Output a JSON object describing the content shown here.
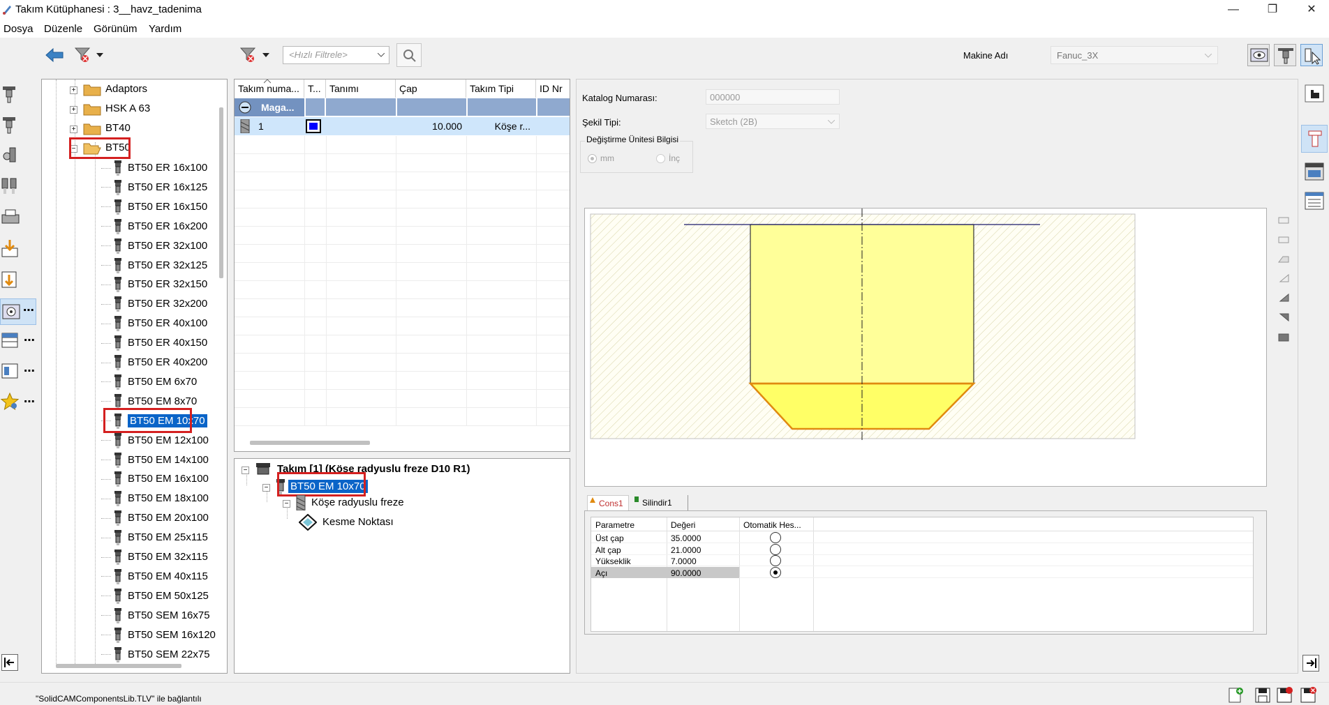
{
  "window": {
    "title": "Takım Kütüphanesi : 3__havz_tadenima",
    "minimize": "—",
    "maximize": "❐",
    "close": "✕"
  },
  "menu": [
    "Dosya",
    "Düzenle",
    "Görünüm",
    "Yardım"
  ],
  "toolbar": {
    "filter_placeholder": "<Hızlı Filtrele>",
    "machine_label": "Makine Adı",
    "machine_value": "Fanuc_3X"
  },
  "tree": {
    "folders": [
      "Adaptors",
      "HSK A 63",
      "BT40",
      "BT50"
    ],
    "items": [
      "BT50 ER 16x100",
      "BT50 ER 16x125",
      "BT50 ER 16x150",
      "BT50 ER 16x200",
      "BT50 ER 32x100",
      "BT50 ER 32x125",
      "BT50 ER 32x150",
      "BT50 ER 32x200",
      "BT50 ER 40x100",
      "BT50 ER 40x150",
      "BT50 ER 40x200",
      "BT50 EM 6x70",
      "BT50 EM 8x70",
      "BT50 EM 10x70",
      "BT50 EM 12x100",
      "BT50 EM 14x100",
      "BT50 EM 16x100",
      "BT50 EM 18x100",
      "BT50 EM 20x100",
      "BT50 EM 25x115",
      "BT50 EM 32x115",
      "BT50 EM 40x115",
      "BT50 EM 50x125",
      "BT50 SEM 16x75",
      "BT50 SEM 16x120",
      "BT50 SEM 22x75"
    ],
    "selected": "BT50 EM 10x70"
  },
  "tool_table": {
    "headers": [
      "Takım numa...",
      "T...",
      "Tanımı",
      "Çap",
      "Takım Tipi",
      "ID Nr"
    ],
    "group_label": "Maga...",
    "row": {
      "number": "1",
      "diameter": "10.000",
      "type": "Köşe r..."
    },
    "color_swatch": "#0000ff"
  },
  "assembly_tree": {
    "root": "Takım [1] (Köşe radyuslu freze D10 R1)",
    "holder": "BT50 EM 10x70",
    "cutter": "Köşe radyuslu freze",
    "point": "Kesme Noktası"
  },
  "properties": {
    "catalog_label": "Katalog Numarası:",
    "catalog_value": "000000",
    "shape_label": "Şekil Tipi:",
    "shape_value": "Sketch (2B)",
    "unit_group_label": "Değiştirme Ünitesi Bilgisi",
    "unit_mm": "mm",
    "unit_inch": "İnç"
  },
  "tabs": [
    "Cons1",
    "Silindir1"
  ],
  "params": {
    "headers": [
      "Parametre",
      "Değeri",
      "Otomatik Hes..."
    ],
    "rows": [
      {
        "name": "Üst çap",
        "value": "35.0000",
        "auto": false
      },
      {
        "name": "Alt çap",
        "value": "21.0000",
        "auto": false
      },
      {
        "name": "Yükseklik",
        "value": "7.0000",
        "auto": false
      },
      {
        "name": "Açı",
        "value": "90.0000",
        "auto": true
      }
    ]
  },
  "status": {
    "text": "\"SolidCAMComponentsLib.TLV\" ile bağlantılı"
  },
  "colors": {
    "selection": "#0a64c8",
    "highlight_box": "#d42020",
    "drawing_fill": "#ffff99",
    "drawing_edge": "#e08a10",
    "table_group": "#8fa9cf"
  }
}
